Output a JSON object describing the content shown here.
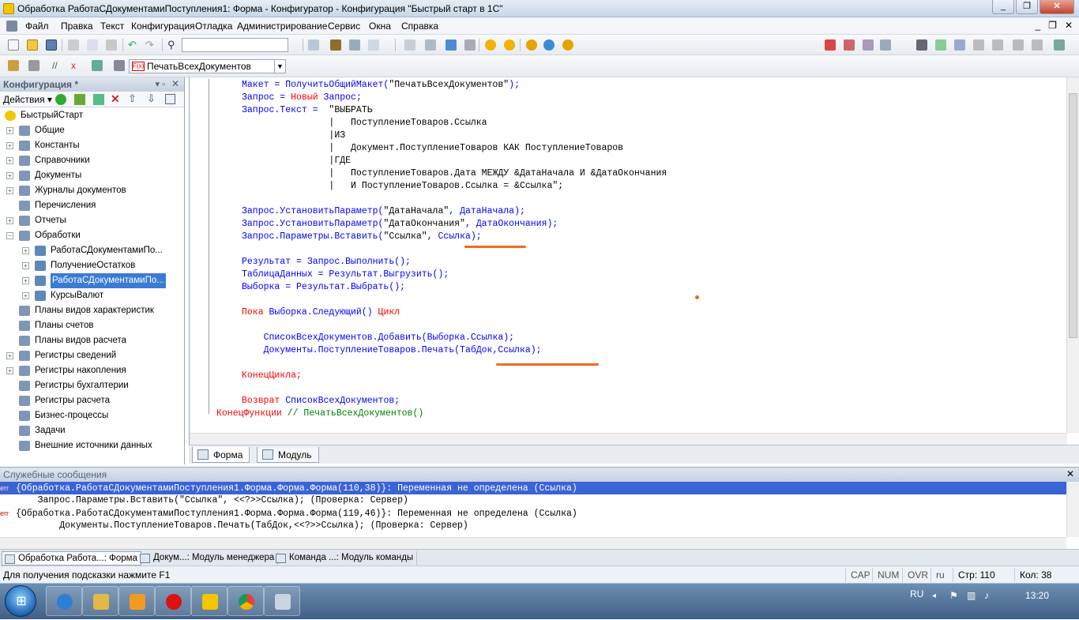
{
  "window": {
    "title": "Обработка РаботаСДокументамиПоступления1: Форма - Конфигуратор - Конфигурация \"Быстрый старт в 1С\""
  },
  "menu": {
    "items": [
      "Файл",
      "Правка",
      "Текст",
      "Конфигурация",
      "Отладка",
      "Администрирование",
      "Сервис",
      "Окна",
      "Справка"
    ]
  },
  "toolbar": {
    "search_value": "",
    "proc_combo": "ПечатьВсехДокументов"
  },
  "config_panel": {
    "title": "Конфигурация *",
    "actions_label": "Действия",
    "tree": [
      {
        "label": "БыстрыйСтарт",
        "level": 0,
        "expander": "",
        "icon": "config-icon"
      },
      {
        "label": "Общие",
        "level": 1,
        "expander": "+",
        "icon": "common-icon"
      },
      {
        "label": "Константы",
        "level": 1,
        "expander": "+",
        "icon": "constants-icon"
      },
      {
        "label": "Справочники",
        "level": 1,
        "expander": "+",
        "icon": "catalogs-icon"
      },
      {
        "label": "Документы",
        "level": 1,
        "expander": "+",
        "icon": "documents-icon"
      },
      {
        "label": "Журналы документов",
        "level": 1,
        "expander": "+",
        "icon": "journals-icon"
      },
      {
        "label": "Перечисления",
        "level": 1,
        "expander": "",
        "icon": "enums-icon"
      },
      {
        "label": "Отчеты",
        "level": 1,
        "expander": "+",
        "icon": "reports-icon"
      },
      {
        "label": "Обработки",
        "level": 1,
        "expander": "−",
        "icon": "processing-icon"
      },
      {
        "label": "РаботаСДокументамиПо...",
        "level": 2,
        "expander": "+",
        "icon": "processing-item-icon"
      },
      {
        "label": "ПолучениеОстатков",
        "level": 2,
        "expander": "+",
        "icon": "processing-item-icon"
      },
      {
        "label": "РаботаСДокументамиПо...",
        "level": 2,
        "expander": "+",
        "icon": "processing-item-icon",
        "selected": true
      },
      {
        "label": "КурсыВалют",
        "level": 2,
        "expander": "+",
        "icon": "processing-item-icon"
      },
      {
        "label": "Планы видов характеристик",
        "level": 1,
        "expander": "",
        "icon": "char-plans-icon"
      },
      {
        "label": "Планы счетов",
        "level": 1,
        "expander": "",
        "icon": "accounts-icon"
      },
      {
        "label": "Планы видов расчета",
        "level": 1,
        "expander": "",
        "icon": "calc-plans-icon"
      },
      {
        "label": "Регистры сведений",
        "level": 1,
        "expander": "+",
        "icon": "info-registers-icon"
      },
      {
        "label": "Регистры накопления",
        "level": 1,
        "expander": "+",
        "icon": "accum-registers-icon"
      },
      {
        "label": "Регистры бухгалтерии",
        "level": 1,
        "expander": "",
        "icon": "accounting-registers-icon"
      },
      {
        "label": "Регистры расчета",
        "level": 1,
        "expander": "",
        "icon": "calc-registers-icon"
      },
      {
        "label": "Бизнес-процессы",
        "level": 1,
        "expander": "",
        "icon": "bp-icon"
      },
      {
        "label": "Задачи",
        "level": 1,
        "expander": "",
        "icon": "tasks-icon"
      },
      {
        "label": "Внешние источники данных",
        "level": 1,
        "expander": "",
        "icon": "ext-sources-icon"
      }
    ]
  },
  "code": {
    "lines": [
      [
        [
          "Макет = ПолучитьОбщийМакет(",
          "b"
        ],
        [
          "\"ПечатьВсехДокументов\"",
          "k"
        ],
        [
          ");",
          "b"
        ]
      ],
      [
        [
          "Запрос = ",
          "b"
        ],
        [
          "Новый ",
          "r"
        ],
        [
          "Запрос;",
          "b"
        ]
      ],
      [
        [
          "Запрос.Текст =  ",
          "b"
        ],
        [
          "\"ВЫБРАТЬ",
          "k"
        ]
      ],
      [
        [
          "                |   ПоступлениеТоваров.Ссылка",
          "k"
        ]
      ],
      [
        [
          "                |ИЗ",
          "k"
        ]
      ],
      [
        [
          "                |   Документ.ПоступлениеТоваров КАК ПоступлениеТоваров",
          "k"
        ]
      ],
      [
        [
          "                |ГДЕ",
          "k"
        ]
      ],
      [
        [
          "                |   ПоступлениеТоваров.Дата МЕЖДУ &ДатаНачала И &ДатаОкончания",
          "k"
        ]
      ],
      [
        [
          "                |   И ПоступлениеТоваров.Ссылка = &Ссылка\";",
          "k"
        ]
      ],
      [
        [
          "",
          "k"
        ]
      ],
      [
        [
          "Запрос.УстановитьПараметр(",
          "b"
        ],
        [
          "\"ДатаНачала\"",
          "k"
        ],
        [
          ", ДатаНачала);",
          "b"
        ]
      ],
      [
        [
          "Запрос.УстановитьПараметр(",
          "b"
        ],
        [
          "\"ДатаОкончания\"",
          "k"
        ],
        [
          ", ДатаОкончания);",
          "b"
        ]
      ],
      [
        [
          "Запрос.Параметры.Вставить(",
          "b"
        ],
        [
          "\"Ссылка\"",
          "k"
        ],
        [
          ", Ссылка);",
          "b"
        ]
      ],
      [
        [
          "",
          "k"
        ]
      ],
      [
        [
          "Результат = Запрос.Выполнить();",
          "b"
        ]
      ],
      [
        [
          "ТаблицаДанных = Результат.Выгрузить();",
          "b"
        ]
      ],
      [
        [
          "Выборка = Результат.Выбрать();",
          "b"
        ]
      ],
      [
        [
          "",
          "k"
        ]
      ],
      [
        [
          "Пока ",
          "r"
        ],
        [
          "Выборка.Следующий() ",
          "b"
        ],
        [
          "Цикл",
          "r"
        ]
      ],
      [
        [
          "",
          "k"
        ]
      ],
      [
        [
          "    СписокВсехДокументов.Добавить(Выборка.Ссылка);",
          "b"
        ]
      ],
      [
        [
          "    Документы.ПоступлениеТоваров.Печать(ТабДок,Ссылка);",
          "b"
        ]
      ],
      [
        [
          "",
          "k"
        ]
      ],
      [
        [
          "КонецЦикла;",
          "r"
        ]
      ],
      [
        [
          "",
          "k"
        ]
      ],
      [
        [
          "Возврат ",
          "r"
        ],
        [
          "СписокВсехДокументов;",
          "b"
        ]
      ],
      [
        [
          "КонецФункции ",
          "r"
        ],
        [
          "// ПечатьВсехДокументов()",
          "g"
        ]
      ]
    ]
  },
  "form_tabs": [
    "Форма",
    "Модуль"
  ],
  "messages": {
    "title": "Служебные сообщения",
    "err_tag": "err",
    "lines": [
      {
        "err": true,
        "text": "{Обработка.РаботаСДокументамиПоступления1.Форма.Форма.Форма(110,38)}: Переменная не определена (Ссылка)",
        "highlight": true
      },
      {
        "err": false,
        "text": "    Запрос.Параметры.Вставить(\"Ссылка\", <<?>>Ссылка); (Проверка: Сервер)"
      },
      {
        "err": true,
        "text": "{Обработка.РаботаСДокументамиПоступления1.Форма.Форма.Форма(119,46)}: Переменная не определена (Ссылка)"
      },
      {
        "err": false,
        "text": "        Документы.ПоступлениеТоваров.Печать(ТабДок,<<?>>Ссылка); (Проверка: Сервер)"
      }
    ]
  },
  "window_tabs": [
    "Обработка Работа...: Форма",
    "Докум...: Модуль менеджера",
    "Команда ...: Модуль команды"
  ],
  "status": {
    "hint": "Для получения подсказки нажмите F1",
    "cap": "CAP",
    "num": "NUM",
    "ovr": "OVR",
    "lang": "ru",
    "line": "Стр: 110",
    "col": "Кол: 38"
  },
  "taskbar": {
    "lang": "RU",
    "time": "13:20"
  },
  "colors": {
    "accent": "#3a63d6",
    "underline": "#ee6b20",
    "keyword": "#ff0000",
    "ident": "#0000ff",
    "comment": "#008000"
  }
}
